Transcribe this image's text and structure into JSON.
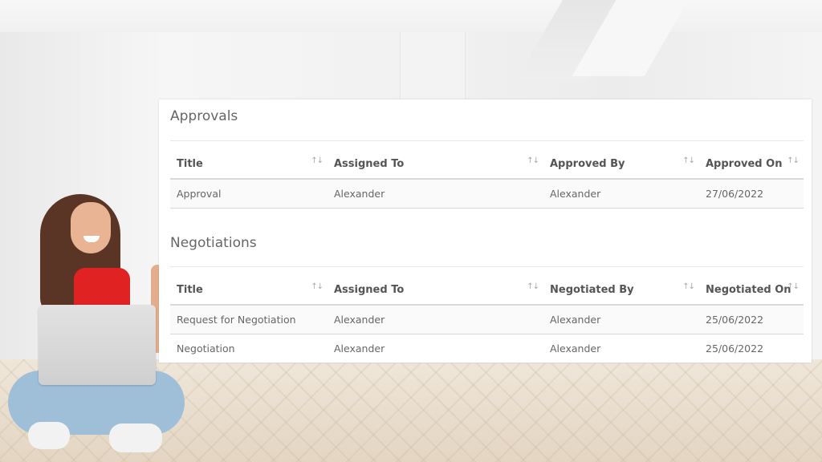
{
  "approvals": {
    "title": "Approvals",
    "columns": [
      "Title",
      "Assigned To",
      "Approved By",
      "Approved On"
    ],
    "rows": [
      [
        "Approval",
        "Alexander",
        "Alexander",
        "27/06/2022"
      ]
    ]
  },
  "negotiations": {
    "title": "Negotiations",
    "columns": [
      "Title",
      "Assigned To",
      "Negotiated By",
      "Negotiated On"
    ],
    "rows": [
      [
        "Request for Negotiation",
        "Alexander",
        "Alexander",
        "25/06/2022"
      ],
      [
        "Negotiation",
        "Alexander",
        "Alexander",
        "25/06/2022"
      ]
    ]
  },
  "icons": {
    "sort": "↑↓"
  }
}
